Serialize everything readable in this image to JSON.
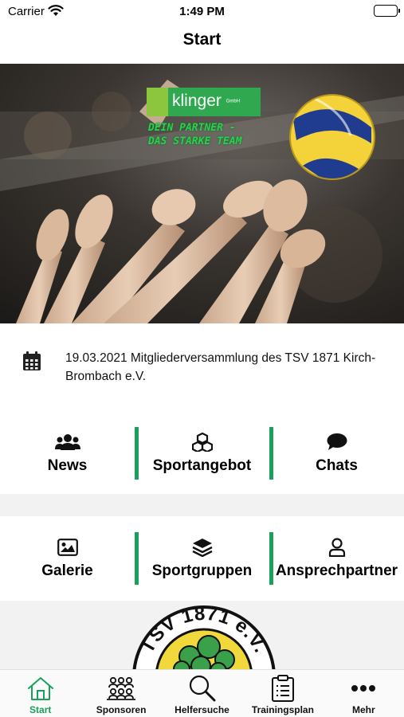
{
  "status_bar": {
    "carrier": "Carrier",
    "time": "1:49 PM"
  },
  "nav": {
    "title": "Start"
  },
  "hero": {
    "sponsor_brand": "klinger",
    "sponsor_suffix": "GmbH",
    "slogan_line1": "DEIN PARTNER -",
    "slogan_line2": "DAS STARKE TEAM"
  },
  "event": {
    "text": "19.03.2021 Mitgliederversammlung des TSV 1871 Kirch-Brombach e.V."
  },
  "tiles_row1": [
    {
      "label": "News",
      "icon": "users-icon"
    },
    {
      "label": "Sportangebot",
      "icon": "cubes-icon"
    },
    {
      "label": "Chats",
      "icon": "chat-bubble-icon"
    }
  ],
  "tiles_row2": [
    {
      "label": "Galerie",
      "icon": "image-icon"
    },
    {
      "label": "Sportgruppen",
      "icon": "layers-icon"
    },
    {
      "label": "Ansprechpartner",
      "icon": "person-icon"
    }
  ],
  "club_logo": {
    "text": "TSV 1871 e.V."
  },
  "tabbar": {
    "tabs": [
      {
        "label": "Start",
        "icon": "house-icon",
        "active": true
      },
      {
        "label": "Sponsoren",
        "icon": "audience-icon"
      },
      {
        "label": "Helfersuche",
        "icon": "magnifier-icon"
      },
      {
        "label": "Trainingsplan",
        "icon": "clipboard-icon"
      },
      {
        "label": "Mehr",
        "icon": "ellipsis-icon"
      }
    ]
  },
  "colors": {
    "accent": "#1aa05a",
    "sponsor_green": "#2fa84f",
    "section_gap": "#f2f2f2"
  }
}
